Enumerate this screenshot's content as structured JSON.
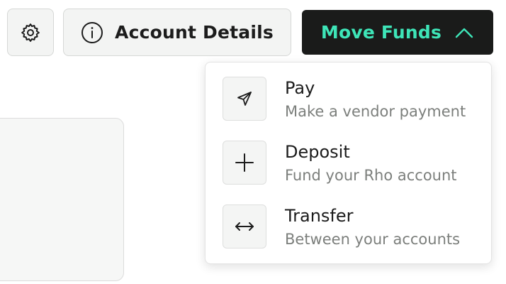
{
  "toolbar": {
    "settings_icon": "gear-icon",
    "account_details_label": "Account Details",
    "account_details_icon": "info-circle-icon",
    "move_funds_label": "Move Funds",
    "move_funds_icon": "chevron-up-icon"
  },
  "colors": {
    "move_funds_bg": "#1a1b1a",
    "move_funds_text": "#3ee5b8",
    "button_bg": "#f3f4f3",
    "subtitle_text": "#7c7f7c"
  },
  "move_funds_menu": {
    "items": [
      {
        "title": "Pay",
        "subtitle": "Make a vendor payment",
        "icon": "send-icon"
      },
      {
        "title": "Deposit",
        "subtitle": "Fund your Rho account",
        "icon": "plus-icon"
      },
      {
        "title": "Transfer",
        "subtitle": "Between your accounts",
        "icon": "arrows-left-right-icon"
      }
    ]
  }
}
